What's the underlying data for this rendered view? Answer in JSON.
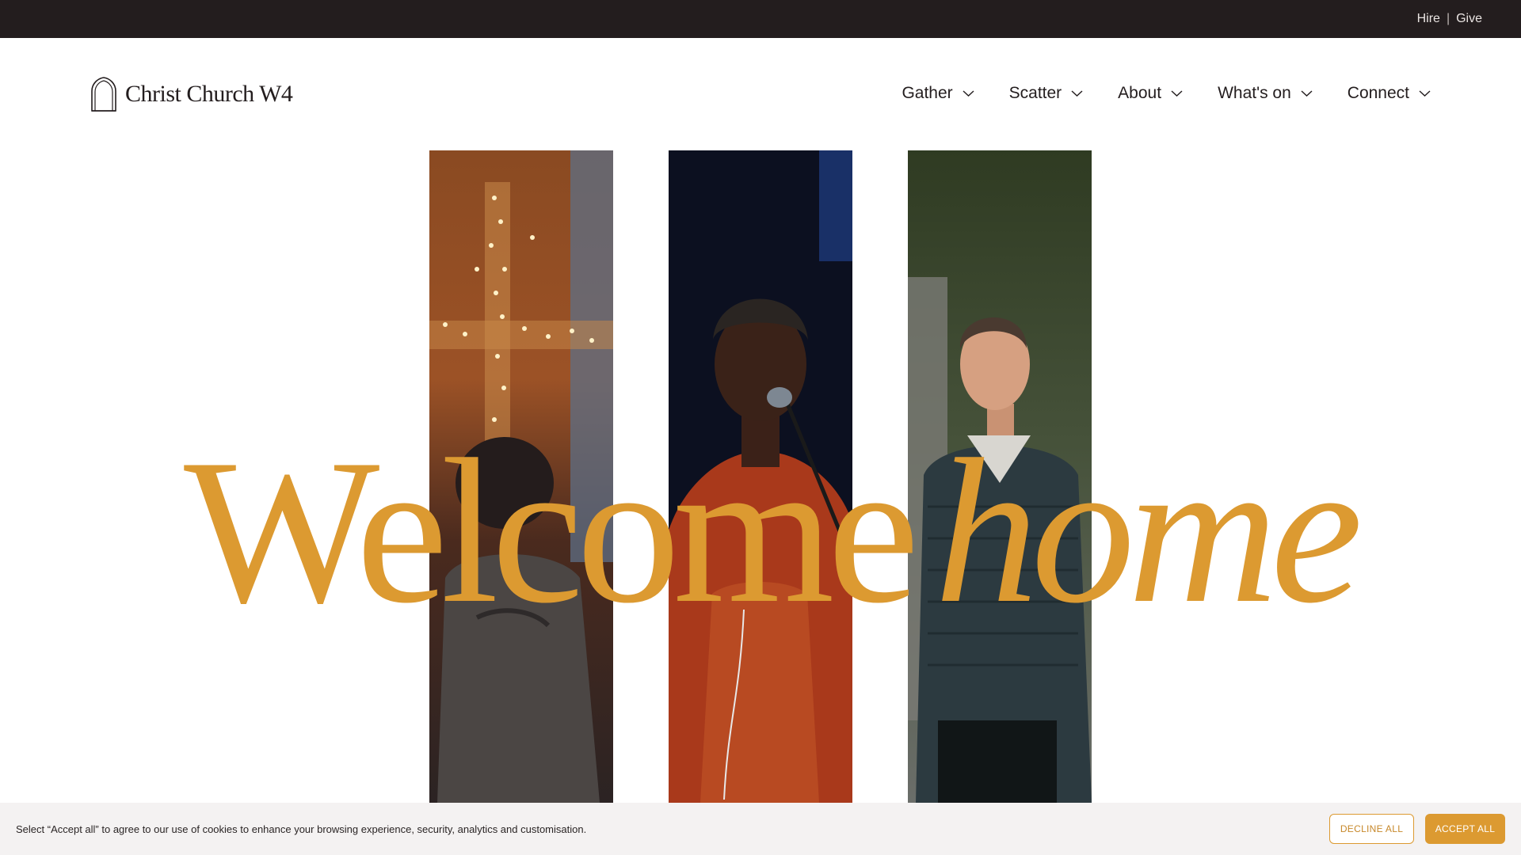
{
  "topbar": {
    "links": [
      "Hire",
      "Give"
    ],
    "separator": "|"
  },
  "brand": {
    "name": "Christ Church W4",
    "icon": "arched-window-icon"
  },
  "nav": {
    "items": [
      {
        "label": "Gather",
        "icon": "chevron-down-icon"
      },
      {
        "label": "Scatter",
        "icon": "chevron-down-icon"
      },
      {
        "label": "About",
        "icon": "chevron-down-icon"
      },
      {
        "label": "What's on",
        "icon": "chevron-down-icon"
      },
      {
        "label": "Connect",
        "icon": "chevron-down-icon"
      }
    ]
  },
  "hero": {
    "headline_word_1": "Welcome",
    "headline_word_2": "home",
    "images": [
      "cross-lights-photo",
      "singer-photo",
      "smiling-man-photo"
    ]
  },
  "cookie": {
    "text": "Select “Accept all” to agree to our use of cookies to enhance your browsing experience, security, analytics and customisation.",
    "decline_label": "DECLINE ALL",
    "accept_label": "ACCEPT ALL"
  },
  "colors": {
    "accent": "#dc9a31",
    "topbar": "#231d1e",
    "text": "#231d1e",
    "banner": "#f4f2f2"
  }
}
